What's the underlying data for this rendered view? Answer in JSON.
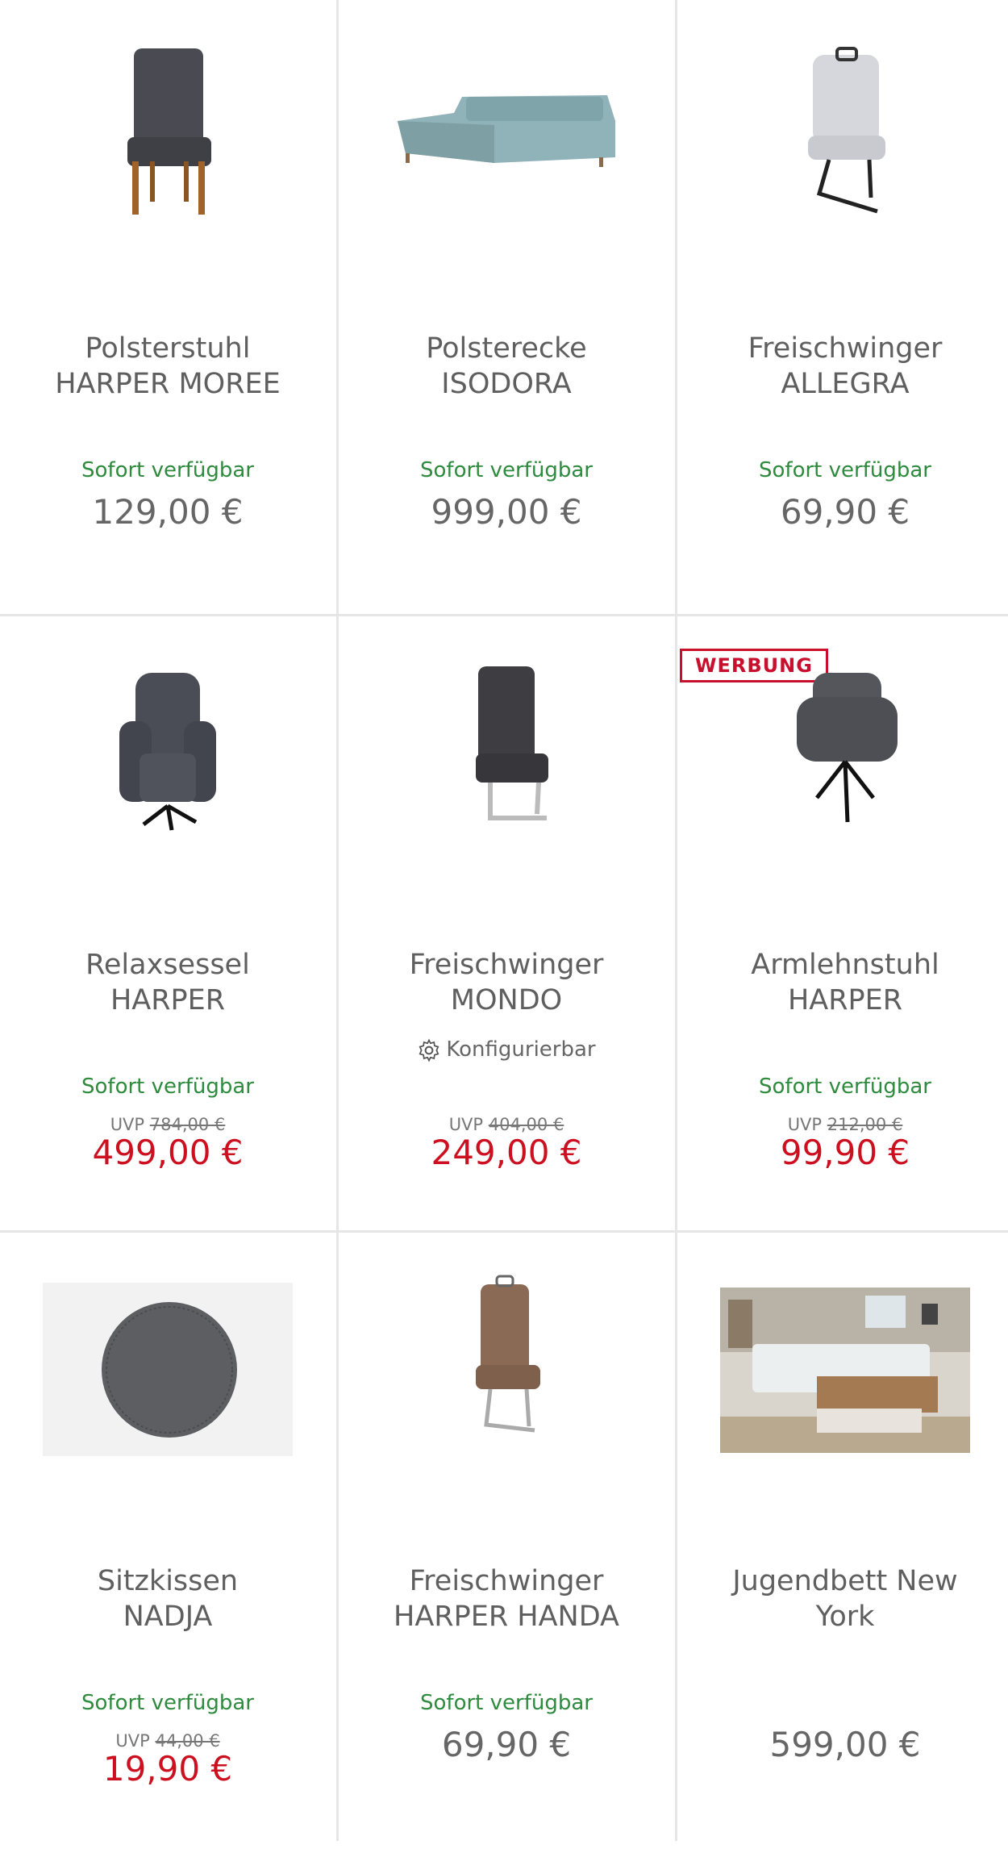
{
  "products": [
    {
      "line1": "Polsterstuhl",
      "line2": "HARPER MOREE",
      "availability": "Sofort verfügbar",
      "price": "129,00 €"
    },
    {
      "line1": "Polsterecke",
      "line2": "ISODORA",
      "availability": "Sofort verfügbar",
      "price": "999,00 €"
    },
    {
      "line1": "Freischwinger",
      "line2": "ALLEGRA",
      "availability": "Sofort verfügbar",
      "price": "69,90 €"
    },
    {
      "line1": "Relaxsessel",
      "line2": "HARPER",
      "availability": "Sofort verfügbar",
      "uvp_label": "UVP",
      "uvp": "784,00 €",
      "price": "499,00 €"
    },
    {
      "line1": "Freischwinger",
      "line2": "MONDO",
      "config": "Konfigurierbar",
      "uvp_label": "UVP",
      "uvp": "404,00 €",
      "price": "249,00 €"
    },
    {
      "badge": "WERBUNG",
      "line1": "Armlehnstuhl",
      "line2": "HARPER",
      "availability": "Sofort verfügbar",
      "uvp_label": "UVP",
      "uvp": "212,00 €",
      "price": "99,90 €"
    },
    {
      "line1": "Sitzkissen",
      "line2": "NADJA",
      "availability": "Sofort verfügbar",
      "uvp_label": "UVP",
      "uvp": "44,00 €",
      "price": "19,90 €"
    },
    {
      "line1": "Freischwinger",
      "line2": "HARPER HANDA",
      "availability": "Sofort verfügbar",
      "price": "69,90 €"
    },
    {
      "line1": "Jugendbett New",
      "line2": "York",
      "price": "599,00 €"
    }
  ],
  "colors": {
    "available": "#2e8b3e",
    "sale": "#cc1020",
    "badge": "#c8102e"
  }
}
